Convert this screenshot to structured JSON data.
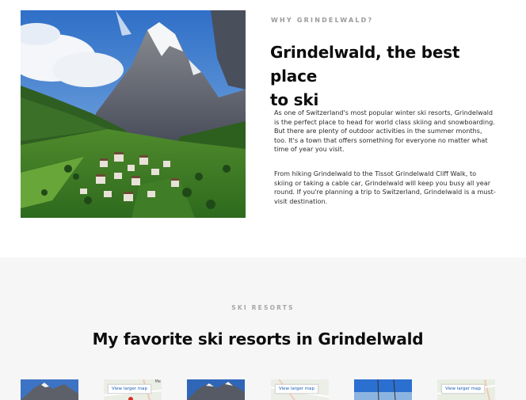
{
  "about": {
    "eyebrow": "WHY GRINDELWALD?",
    "title_line1": "Grindelwald, the best place",
    "title_line2": "to ski",
    "paragraph1": "As one of Switzerland's most popular winter ski resorts, Grindelwald is the perfect place to head for world class skiing and snowboarding. But there are plenty of outdoor activities in the summer months, too. It's a town that offers something for everyone no matter what time of year you visit.",
    "paragraph2": "From hiking Grindelwald to the Tissot Grindelwald Cliff Walk, to skiing or taking a cable car, Grindelwald will keep you busy all year round. If you're planning a trip to Switzerland, Grindelwald is a must-visit destination."
  },
  "resorts": {
    "eyebrow": "SKI RESORTS",
    "title": "My favorite ski resorts in Grindelwald",
    "cards": [
      {
        "map_button": "View larger map",
        "map_corner": "Me"
      },
      {
        "map_button": "View larger map",
        "map_corner": ""
      },
      {
        "map_button": "View larger map",
        "map_corner": ""
      }
    ]
  },
  "colors": {
    "section_background": "#f6f6f7",
    "eyebrow_gray": "#9a9a9a",
    "map_link_blue": "#1a5fb4"
  }
}
